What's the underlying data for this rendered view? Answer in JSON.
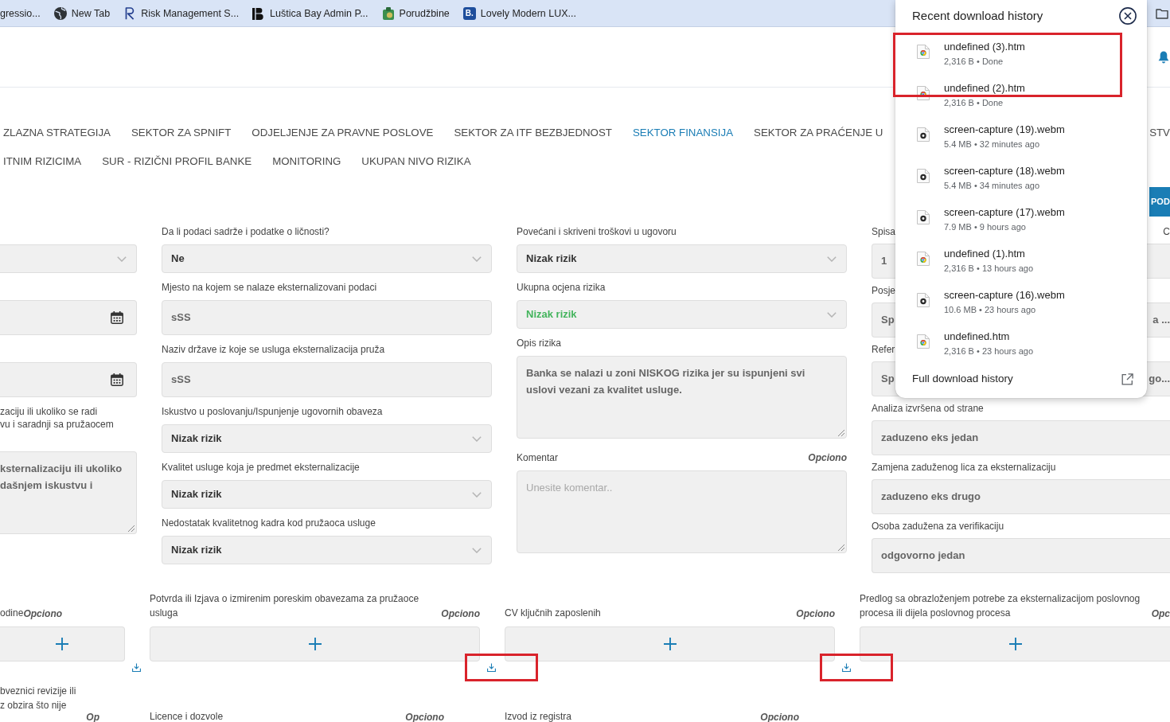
{
  "bookmarks": [
    {
      "kind": "none",
      "label": "gressio..."
    },
    {
      "kind": "globe",
      "label": "New Tab"
    },
    {
      "kind": "r-logo",
      "label": "Risk Management S..."
    },
    {
      "kind": "lb-logo",
      "label": "Luštica Bay Admin P..."
    },
    {
      "kind": "shop",
      "label": "Porudžbine"
    },
    {
      "kind": "tile",
      "tile_text": "B.",
      "label": "Lovely Modern LUX..."
    }
  ],
  "tab_rows": [
    [
      {
        "label": "ZLAZNA STRATEGIJA",
        "selected": false
      },
      {
        "label": "SEKTOR ZA SPNIFT",
        "selected": false
      },
      {
        "label": "ODJELJENJE ZA PRAVNE POSLOVE",
        "selected": false
      },
      {
        "label": "SEKTOR ZA ITF BEZBJEDNOST",
        "selected": false
      },
      {
        "label": "SEKTOR FINANSIJA",
        "selected": true
      },
      {
        "label": "SEKTOR ZA PRAĆENJE U",
        "selected": false
      },
      {
        "label": "STV",
        "selected": false
      }
    ],
    [
      {
        "label": "ITNIM RIZICIMA",
        "selected": false
      },
      {
        "label": "SUR - RIZIČNI PROFIL BANKE",
        "selected": false
      },
      {
        "label": "MONITORING",
        "selected": false
      },
      {
        "label": "UKUPAN NIVO RIZIKA",
        "selected": false
      }
    ]
  ],
  "action_button": {
    "label": "POD"
  },
  "form": {
    "columns": [
      {
        "fields": [
          {
            "kind": "select"
          },
          {
            "kind": "date"
          },
          {
            "kind": "date"
          },
          {
            "kind": "textarea",
            "label": "zaciju ili ukoliko se radi\nvu i saradnji sa pružaocem",
            "value": "ksternalizaciju ili ukoliko\ndašnjem iskustvu i"
          }
        ]
      },
      {
        "fields": [
          {
            "kind": "select",
            "label": "Da li podaci sadrže i podatke o ličnosti?",
            "value": "Ne"
          },
          {
            "kind": "text",
            "label": "Mjesto na kojem se nalaze eksternalizovani podaci",
            "value": "sSS"
          },
          {
            "kind": "text",
            "label": "Naziv države iz koje se usluga eksternalizacija pruža",
            "value": "sSS"
          },
          {
            "kind": "select",
            "label": "Iskustvo u poslovanju/Ispunjenje ugovornih obaveza",
            "value": "Nizak rizik"
          },
          {
            "kind": "select",
            "label": "Kvalitet usluge koja je predmet eksternalizacije",
            "value": "Nizak rizik"
          },
          {
            "kind": "select",
            "label": "Nedostatak kvalitetnog kadra kod pružaoca usluge",
            "value": "Nizak rizik"
          }
        ]
      },
      {
        "fields": [
          {
            "kind": "select",
            "label": "Povećani i skriveni troškovi u ugovoru",
            "value": "Nizak rizik"
          },
          {
            "kind": "select",
            "label": "Ukupna ocjena rizika",
            "value": "Nizak rizik",
            "color": "#43b45c"
          },
          {
            "kind": "textarea",
            "label": "Opis rizika",
            "value": "Banka se nalazi u zoni NISKOG rizika jer su ispunjeni svi uslovi vezani za kvalitet usluge."
          },
          {
            "kind": "textarea",
            "label": "Komentar",
            "optional": "Opciono",
            "placeholder": "Unesite komentar.."
          }
        ]
      },
      {
        "fields": [
          {
            "kind": "text",
            "label": "Spisa",
            "side_label": "C",
            "value": "1"
          },
          {
            "kind": "text",
            "label": "Posje",
            "value": "Sp",
            "value_tail": "a ..."
          },
          {
            "kind": "text",
            "label": "Refer",
            "value": "Sp",
            "value_tail": "go..."
          },
          {
            "kind": "text",
            "label": "Analiza izvršena od strane",
            "value": "zaduzeno eks jedan"
          },
          {
            "kind": "text",
            "label": "Zamjena zaduženog lica za eksternalizaciju",
            "value": "zaduzeno eks drugo"
          },
          {
            "kind": "text",
            "label": "Osoba zadužena za verifikaciju",
            "value": "odgovorno jedan"
          }
        ]
      }
    ]
  },
  "attachments": [
    {
      "label": "odine",
      "optional": "Opciono",
      "downloadable": true,
      "highlighted": false
    },
    {
      "label": "Potvrda ili Izjava o izmirenim poreskim obavezama za pružaoce usluga",
      "optional": "Opciono",
      "downloadable": true,
      "highlighted": true
    },
    {
      "label": "CV ključnih zaposlenih",
      "optional": "Opciono",
      "downloadable": true,
      "highlighted": true
    },
    {
      "label": "Predlog sa obrazloženjem potrebe za eksternalizacijom poslovnog procesa ili dijela poslovnog procesa",
      "optional": "Opc",
      "downloadable": false
    }
  ],
  "attachments_more": [
    {
      "label": "bveznici revizije ili\nz obzira što nije",
      "optional": "Op"
    },
    {
      "label": "Licence i dozvole",
      "optional": "Opciono"
    },
    {
      "label": "Izvod iz registra",
      "optional": "Opciono"
    }
  ],
  "downloads_panel": {
    "title": "Recent download history",
    "items": [
      {
        "kind": "page",
        "name": "undefined (3).htm",
        "meta": "2,316 B • Done",
        "highlighted": true
      },
      {
        "kind": "page",
        "name": "undefined (2).htm",
        "meta": "2,316 B • Done",
        "highlighted": true
      },
      {
        "kind": "video",
        "name": "screen-capture (19).webm",
        "meta": "5.4 MB • 32 minutes ago",
        "highlighted": false
      },
      {
        "kind": "video",
        "name": "screen-capture (18).webm",
        "meta": "5.4 MB • 34 minutes ago",
        "highlighted": false
      },
      {
        "kind": "video",
        "name": "screen-capture (17).webm",
        "meta": "7.9 MB • 9 hours ago",
        "highlighted": false
      },
      {
        "kind": "page",
        "name": "undefined (1).htm",
        "meta": "2,316 B • 13 hours ago",
        "highlighted": false
      },
      {
        "kind": "video",
        "name": "screen-capture (16).webm",
        "meta": "10.6 MB • 23 hours ago",
        "highlighted": false
      },
      {
        "kind": "page",
        "name": "undefined.htm",
        "meta": "2,316 B • 23 hours ago",
        "highlighted": false
      }
    ],
    "footer": "Full download history"
  }
}
